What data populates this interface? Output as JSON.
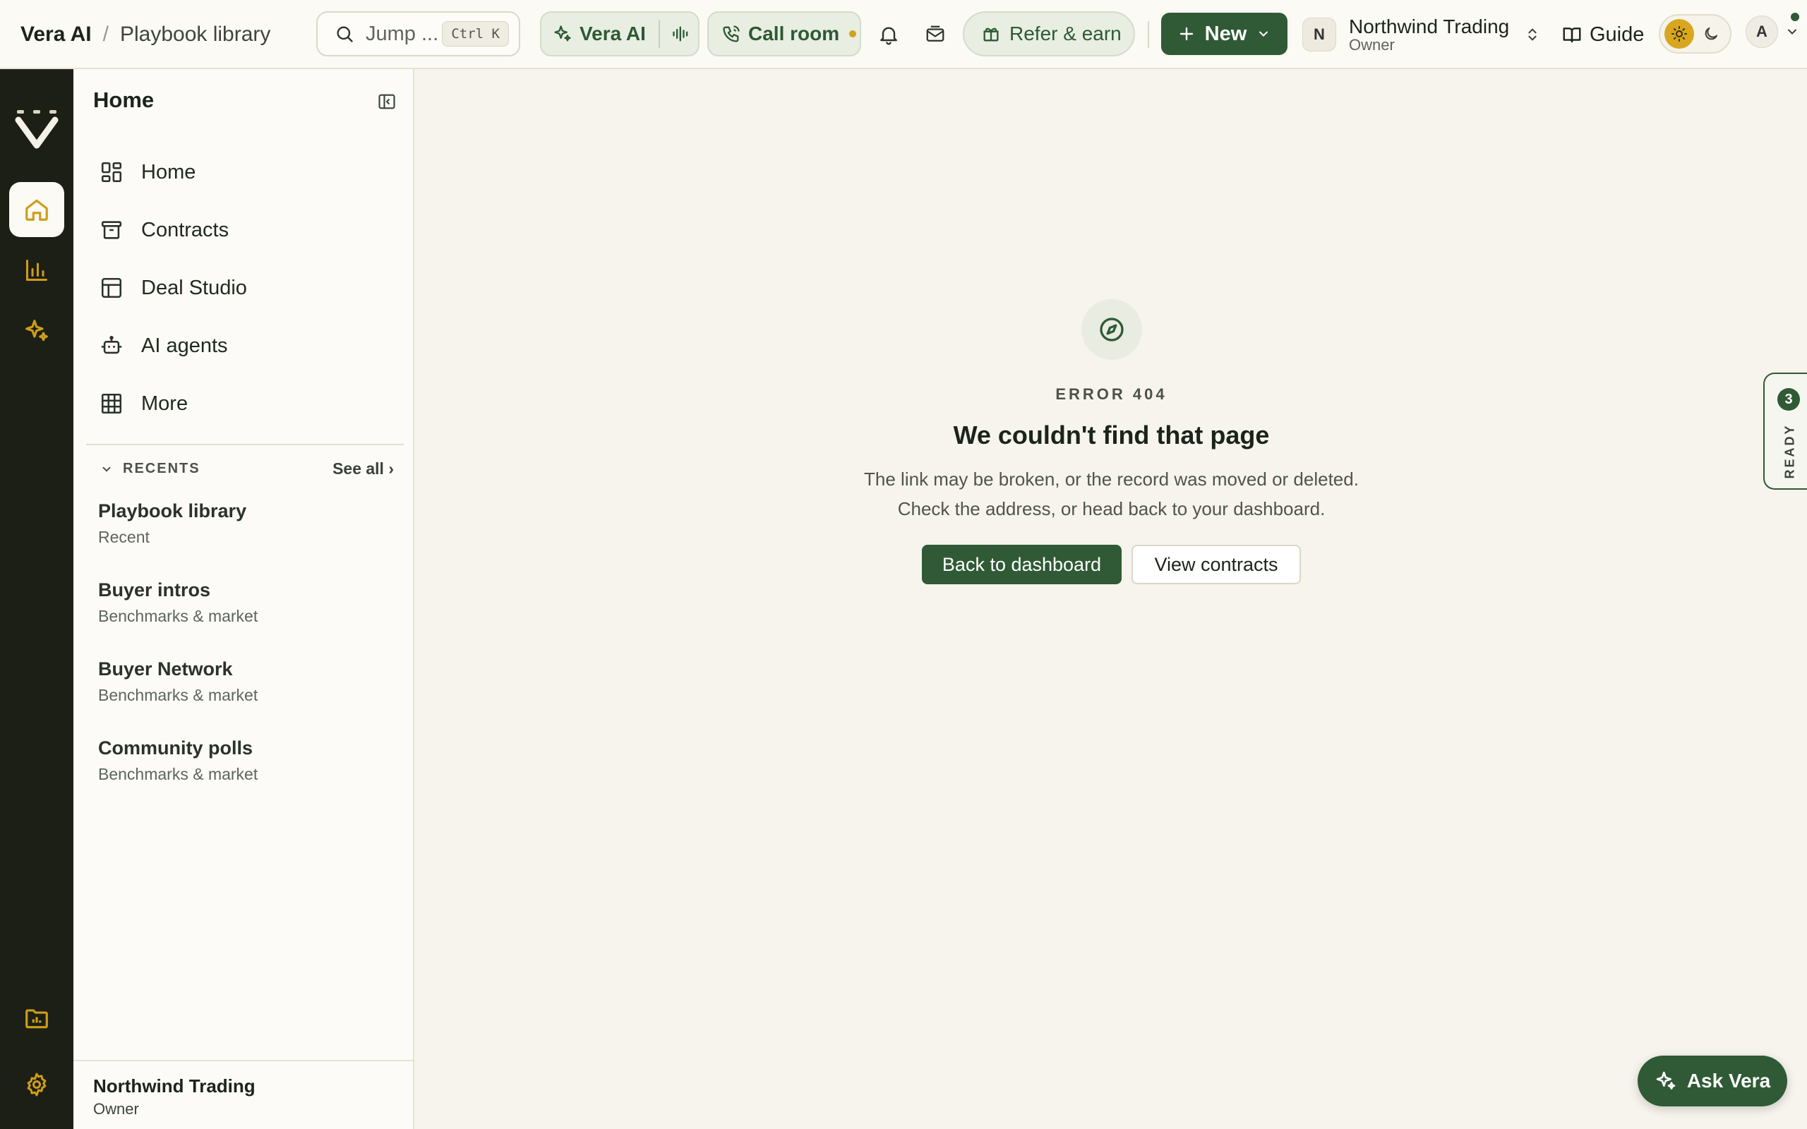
{
  "breadcrumb": {
    "app": "Vera AI",
    "separator": "/",
    "page": "Playbook library"
  },
  "search": {
    "placeholder": "Jump ...",
    "shortcut": "Ctrl K"
  },
  "topbar": {
    "vera_ai_label": "Vera AI",
    "call_room_label": "Call room",
    "refer_label": "Refer & earn",
    "new_label": "New",
    "guide_label": "Guide"
  },
  "org": {
    "initial": "N",
    "name": "Northwind Trading",
    "role": "Owner"
  },
  "user": {
    "initial": "A"
  },
  "sidebar": {
    "heading": "Home",
    "items": [
      {
        "label": "Home",
        "icon": "dashboard-grid-icon"
      },
      {
        "label": "Contracts",
        "icon": "archive-box-icon"
      },
      {
        "label": "Deal Studio",
        "icon": "layout-panel-icon"
      },
      {
        "label": "AI agents",
        "icon": "robot-icon"
      },
      {
        "label": "More",
        "icon": "grid-icon"
      }
    ],
    "recents_label": "RECENTS",
    "see_all": "See all ›",
    "recents": [
      {
        "title": "Playbook library",
        "subtitle": "Recent"
      },
      {
        "title": "Buyer intros",
        "subtitle": "Benchmarks & market"
      },
      {
        "title": "Buyer Network",
        "subtitle": "Benchmarks & market"
      },
      {
        "title": "Community polls",
        "subtitle": "Benchmarks & market"
      }
    ],
    "footer": {
      "name": "Northwind Trading",
      "role": "Owner"
    }
  },
  "error": {
    "code": "ERROR 404",
    "title": "We couldn't find that page",
    "line1": "The link may be broken, or the record was moved or deleted.",
    "line2": "Check the address, or head back to your dashboard.",
    "primary_button": "Back to dashboard",
    "secondary_button": "View contracts"
  },
  "ready_tab": {
    "count": "3",
    "label": "READY"
  },
  "ask_vera": {
    "label": "Ask Vera"
  },
  "colors": {
    "brand": "#2f5a35",
    "accent": "#d8a71f",
    "rail": "#1c1f16",
    "background": "#f6f4ec"
  }
}
